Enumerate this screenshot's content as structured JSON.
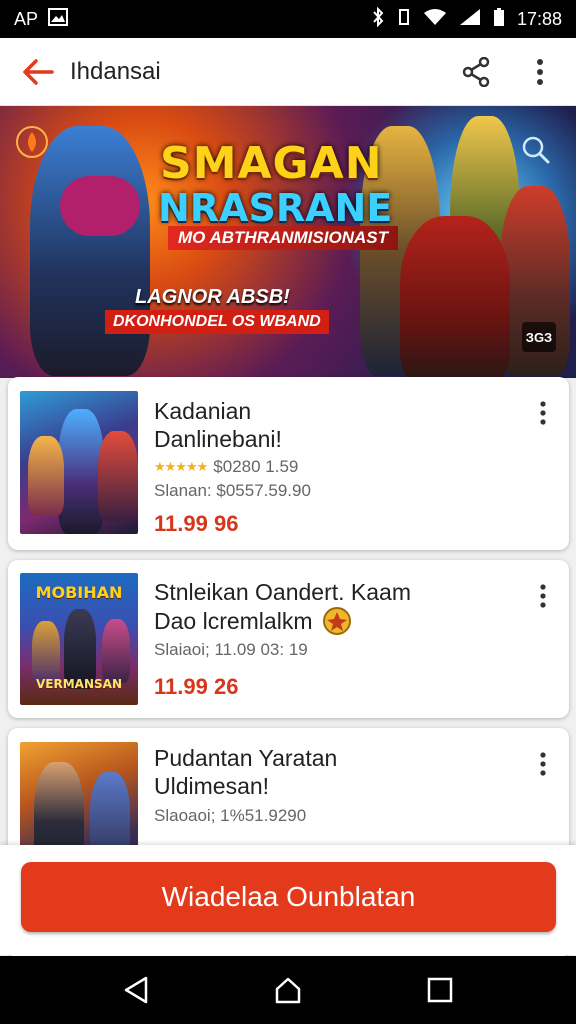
{
  "status_bar": {
    "left_text": "AP",
    "time": "17:88"
  },
  "app_bar": {
    "title": "Ihdansai"
  },
  "banner": {
    "title_line1": "SMAGAN",
    "title_line2": "NRASRANE",
    "subtitle": "MO ABTHRANMISIONAST",
    "tagline": "LAGNOR ABSB!",
    "ribbon": "DKONHONDEL OS WBAND",
    "badge": "ЗGЗ"
  },
  "products": [
    {
      "name_line1": "Kadanian",
      "name_line2": "Danlinebani!",
      "rating": "$0280 1.59",
      "meta": "Slanan: $0557.59.90",
      "price": "11.99 96",
      "thumb_label": ""
    },
    {
      "name_line1": "Stnleikan Oandert. Kaam",
      "name_line2": "Dao lcremlalkm",
      "meta": "Slaiaoi; 11.09 03: 19",
      "price": "11.99 26",
      "thumb_label": "MOBIHAN",
      "thumb_label2": "VERMANSAN"
    },
    {
      "name_line1": "Pudantan Yaratan",
      "name_line2": "Uldimesan!",
      "meta": "Slaoaoi; 1%51.9290",
      "price": ""
    }
  ],
  "cta": {
    "label": "Wiadelaa Ounblatan"
  },
  "colors": {
    "accent": "#e33a1b",
    "price": "#d6361c"
  }
}
